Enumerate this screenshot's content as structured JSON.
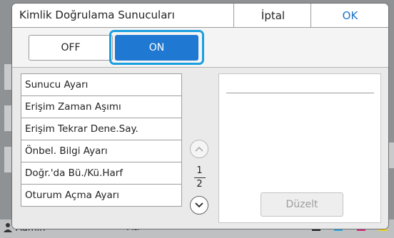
{
  "dialog": {
    "title": "Kimlik Doğrulama Sunucuları",
    "cancel_label": "İptal",
    "ok_label": "OK",
    "accent_color": "#1f78d1",
    "highlight_color": "#1aa0e0"
  },
  "toggle": {
    "off_label": "OFF",
    "on_label": "ON",
    "selected": "ON"
  },
  "settings_list": [
    {
      "label": "Sunucu Ayarı"
    },
    {
      "label": "Erişim Zaman Aşımı"
    },
    {
      "label": "Erişim Tekrar Dene.Say."
    },
    {
      "label": "Önbel. Bilgi Ayarı"
    },
    {
      "label": "Doğr.'da Bü./Kü.Harf"
    },
    {
      "label": "Oturum Açma Ayarı"
    }
  ],
  "pager": {
    "current_page": "1",
    "total_pages": "2",
    "up_icon": "chevron-up-icon",
    "down_icon": "chevron-down-icon"
  },
  "detail": {
    "edit_label": "Düzelt",
    "edit_enabled": false
  },
  "status_bar": {
    "user": "Admin",
    "mode": "Atl",
    "ink_labels": [
      "K",
      "C",
      "M",
      "Y"
    ],
    "ink_colors": [
      "#222222",
      "#2aa6e0",
      "#d9257b",
      "#f2d21a"
    ]
  }
}
